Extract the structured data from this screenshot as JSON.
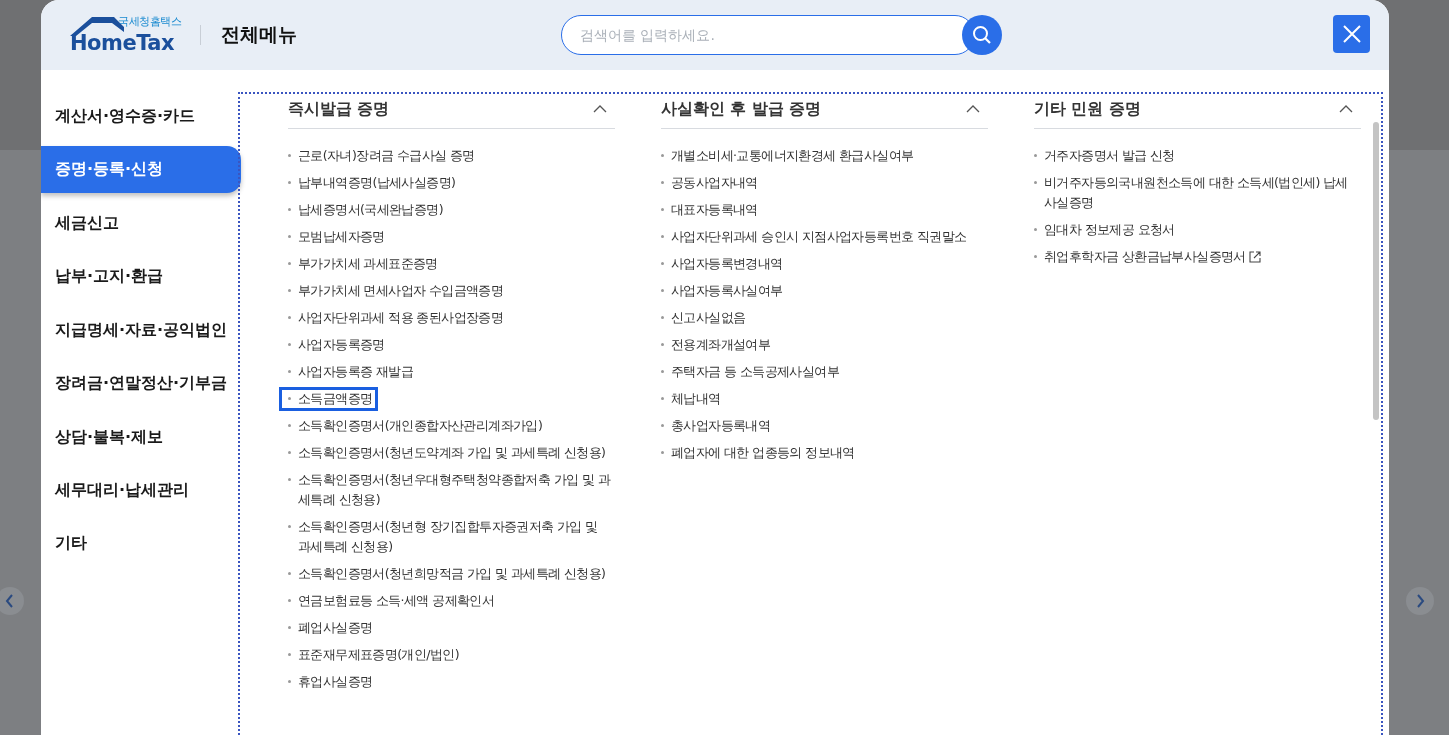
{
  "header": {
    "logo": {
      "small_text": "국세청홈택스",
      "text": "HomeTax"
    },
    "title": "전체메뉴",
    "search": {
      "placeholder": "검색어를 입력하세요."
    }
  },
  "sidebar": {
    "items": [
      {
        "label": "계산서·영수증·카드",
        "selected": false
      },
      {
        "label": "증명·등록·신청",
        "selected": true
      },
      {
        "label": "세금신고",
        "selected": false
      },
      {
        "label": "납부·고지·환급",
        "selected": false
      },
      {
        "label": "지급명세·자료·공익법인",
        "selected": false
      },
      {
        "label": "장려금·연말정산·기부금",
        "selected": false
      },
      {
        "label": "상담·불복·제보",
        "selected": false
      },
      {
        "label": "세무대리·납세관리",
        "selected": false
      },
      {
        "label": "기타",
        "selected": false
      }
    ]
  },
  "columns": [
    {
      "title": "즉시발급 증명",
      "expanded": true,
      "items": [
        {
          "label": "근로(자녀)장려금 수급사실 증명",
          "focused": false
        },
        {
          "label": "납부내역증명(납세사실증명)",
          "focused": false
        },
        {
          "label": "납세증명서(국세완납증명)",
          "focused": false
        },
        {
          "label": "모범납세자증명",
          "focused": false
        },
        {
          "label": "부가가치세 과세표준증명",
          "focused": false
        },
        {
          "label": "부가가치세 면세사업자 수입금액증명",
          "focused": false
        },
        {
          "label": "사업자단위과세 적용 종된사업장증명",
          "focused": false
        },
        {
          "label": "사업자등록증명",
          "focused": false
        },
        {
          "label": "사업자등록증 재발급",
          "focused": false
        },
        {
          "label": "소득금액증명",
          "focused": true
        },
        {
          "label": "소득확인증명서(개인종합자산관리계좌가입)",
          "focused": false
        },
        {
          "label": "소득확인증명서(청년도약계좌 가입 및 과세특례 신청용)",
          "focused": false
        },
        {
          "label": "소득확인증명서(청년우대형주택청약종합저축 가입 및 과세특례 신청용)",
          "focused": false
        },
        {
          "label": "소득확인증명서(청년형 장기집합투자증권저축 가입 및 과세특례 신청용)",
          "focused": false
        },
        {
          "label": "소득확인증명서(청년희망적금 가입 및 과세특례 신청용)",
          "focused": false
        },
        {
          "label": "연금보험료등 소득·세액 공제확인서",
          "focused": false
        },
        {
          "label": "폐업사실증명",
          "focused": false
        },
        {
          "label": "표준재무제표증명(개인/법인)",
          "focused": false
        },
        {
          "label": "휴업사실증명",
          "focused": false
        }
      ]
    },
    {
      "title": "사실확인 후 발급 증명",
      "expanded": true,
      "items": [
        {
          "label": "개별소비세·교통에너지환경세 환급사실여부",
          "focused": false
        },
        {
          "label": "공동사업자내역",
          "focused": false
        },
        {
          "label": "대표자등록내역",
          "focused": false
        },
        {
          "label": "사업자단위과세 승인시 지점사업자등록번호 직권말소",
          "focused": false
        },
        {
          "label": "사업자등록변경내역",
          "focused": false
        },
        {
          "label": "사업자등록사실여부",
          "focused": false
        },
        {
          "label": "신고사실없음",
          "focused": false
        },
        {
          "label": "전용계좌개설여부",
          "focused": false
        },
        {
          "label": "주택자금 등 소득공제사실여부",
          "focused": false
        },
        {
          "label": "체납내역",
          "focused": false
        },
        {
          "label": "총사업자등록내역",
          "focused": false
        },
        {
          "label": "폐업자에 대한 업종등의 정보내역",
          "focused": false
        }
      ]
    },
    {
      "title": "기타 민원 증명",
      "expanded": true,
      "items": [
        {
          "label": "거주자증명서 발급 신청",
          "focused": false,
          "external": false
        },
        {
          "label": "비거주자등의국내원천소득에 대한 소득세(법인세) 납세사실증명",
          "focused": false,
          "external": false
        },
        {
          "label": "임대차 정보제공 요청서",
          "focused": false,
          "external": false
        },
        {
          "label": "취업후학자금 상환금납부사실증명서",
          "focused": false,
          "external": true
        }
      ]
    }
  ]
}
